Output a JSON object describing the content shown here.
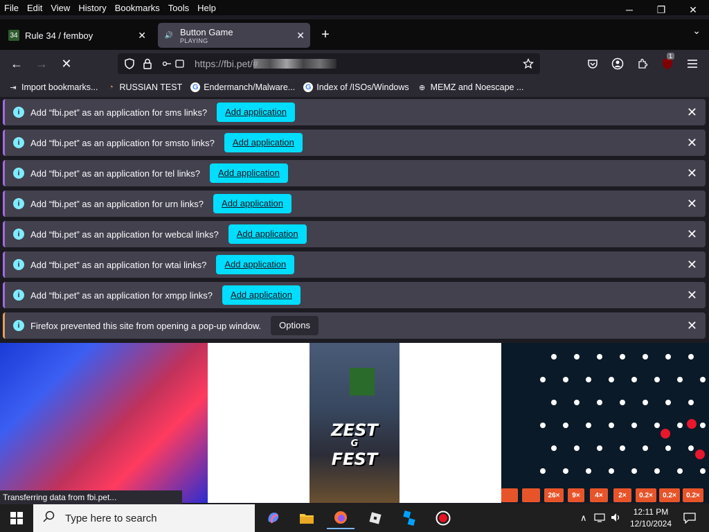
{
  "menu": [
    "File",
    "Edit",
    "View",
    "History",
    "Bookmarks",
    "Tools",
    "Help"
  ],
  "window_controls": {
    "minimize": "─",
    "restore": "❐",
    "close": "✕"
  },
  "tabs": [
    {
      "title": "Rule 34 / femboy",
      "subtitle": "",
      "favicon": "34"
    },
    {
      "title": "Button Game",
      "subtitle": "PLAYING",
      "favicon": "🔊"
    }
  ],
  "new_tab": "+",
  "tab_list": "⌄",
  "nav": {
    "back": "←",
    "forward": "→",
    "stop": "✕",
    "url": "https://fbi.pet/#"
  },
  "toolbar_icons": [
    "star-icon",
    "pocket-icon",
    "account-icon",
    "extensions-icon",
    "ublock-icon",
    "menu-icon"
  ],
  "ublock_badge": "1",
  "bookmarks": [
    {
      "label": "Import bookmarks...",
      "icon": "⇥"
    },
    {
      "label": "RUSSIAN TEST",
      "icon": "◔"
    },
    {
      "label": "Endermanch/Malware...",
      "icon": "G"
    },
    {
      "label": "Index of /ISOs/Windows",
      "icon": "G"
    },
    {
      "label": "MEMZ and Noescape ...",
      "icon": "⊕"
    }
  ],
  "notifications": [
    {
      "message": "Add “fbi.pet” as an application for sms links?",
      "button": "Add application"
    },
    {
      "message": "Add “fbi.pet” as an application for smsto links?",
      "button": "Add application"
    },
    {
      "message": "Add “fbi.pet” as an application for tel links?",
      "button": "Add application"
    },
    {
      "message": "Add “fbi.pet” as an application for urn links?",
      "button": "Add application"
    },
    {
      "message": "Add “fbi.pet” as an application for webcal links?",
      "button": "Add application"
    },
    {
      "message": "Add “fbi.pet” as an application for wtai links?",
      "button": "Add application"
    },
    {
      "message": "Add “fbi.pet” as an application for xmpp links?",
      "button": "Add application"
    }
  ],
  "popup_notice": {
    "message": "Firefox prevented this site from opening a pop-up window.",
    "button": "Options"
  },
  "video_middle": {
    "line1": "ZEST",
    "line2": "G",
    "line3": "FEST"
  },
  "plinko_slots": [
    "",
    "",
    "26×",
    "9×",
    "4×",
    "2×",
    "0.2×",
    "0.2×",
    "0.2×"
  ],
  "status_text": "Transferring data from fbi.pet...",
  "taskbar": {
    "search_placeholder": "Type here to search",
    "apps": [
      "copilot-icon",
      "file-explorer-icon",
      "firefox-icon",
      "roblox-icon",
      "roblox-studio-icon",
      "obs-icon"
    ],
    "time": "12:11 PM",
    "date": "12/10/2024"
  },
  "colors": {
    "accent": "#00ddff",
    "notification_bg": "#42414d",
    "info": "#80ebff"
  }
}
